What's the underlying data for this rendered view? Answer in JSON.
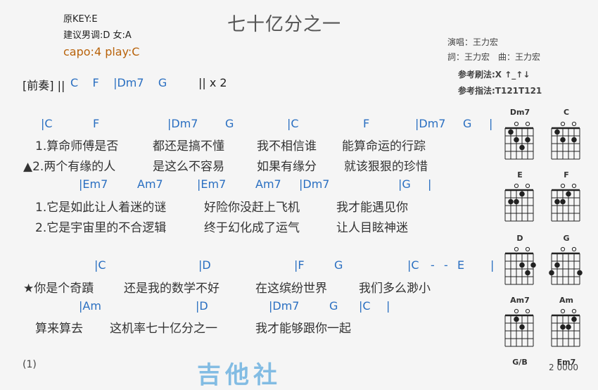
{
  "header": {
    "key": "原KEY:E",
    "suggest": "建议男调:D 女:A",
    "capo": "capo:4 play:C",
    "title": "七十亿分之一",
    "singer": "演唱：王力宏",
    "writers": "詞：王力宏　曲：王力宏",
    "strum": "参考刷法:X ↑_↑↓",
    "finger": "参考指法:T121T121"
  },
  "intro": {
    "label": "[前奏]",
    "bar": "||",
    "chords": "C F |Dm7 G",
    "end": "|| x 2"
  },
  "chord_rows": {
    "row1": [
      "|C",
      "F",
      "|Dm7",
      "G",
      "|C",
      "F",
      "|Dm7",
      "G",
      "|"
    ],
    "row2": [
      "|Em7",
      "Am7",
      "|Em7",
      "Am7",
      "|Dm7",
      "|G",
      "|"
    ],
    "row3": [
      "|C",
      "|D",
      "|F",
      "G",
      "|C",
      "-",
      "-",
      "E",
      "|"
    ],
    "row4": [
      "|Am",
      "|D",
      "|Dm7",
      "G",
      "|C",
      "|"
    ]
  },
  "lyrics": {
    "v1a": [
      "1.算命师傅是否",
      "都还是搞不懂",
      "我不相信谁",
      "能算命运的行踪"
    ],
    "v1b": [
      "▲2.两个有缘的人",
      "是这么不容易",
      "如果有缘分",
      "就该狠狠的珍惜"
    ],
    "v2a": [
      "1.它是如此让人着迷的谜",
      "好险你没赶上飞机",
      "我才能遇见你"
    ],
    "v2b": [
      "2.它是宇宙里的不合逻辑",
      "终于幻化成了运气",
      "让人目眩神迷"
    ],
    "c1": [
      "★你是个奇蹟",
      "还是我的数学不好",
      "在这缤纷世界",
      "我们多么渺小"
    ],
    "c2": [
      "算来算去",
      "这机率七十亿分之一",
      "我才能够跟你一起"
    ]
  },
  "diagrams": [
    {
      "name": "Dm7",
      "fret_label": ""
    },
    {
      "name": "C",
      "fret_label": ""
    },
    {
      "name": "E",
      "fret_label": ""
    },
    {
      "name": "F",
      "fret_label": ""
    },
    {
      "name": "D",
      "fret_label": ""
    },
    {
      "name": "G",
      "fret_label": ""
    },
    {
      "name": "Am7",
      "fret_label": ""
    },
    {
      "name": "Am",
      "fret_label": ""
    },
    {
      "name": "G/B",
      "fret_label": ""
    },
    {
      "name": "Em7",
      "fret_label": ""
    }
  ],
  "footer": {
    "page": "(1)",
    "watermark": "吉他社",
    "extra": "2 0000"
  },
  "colors": {
    "chord": "#2a6fc1",
    "capo": "#b8620a"
  }
}
